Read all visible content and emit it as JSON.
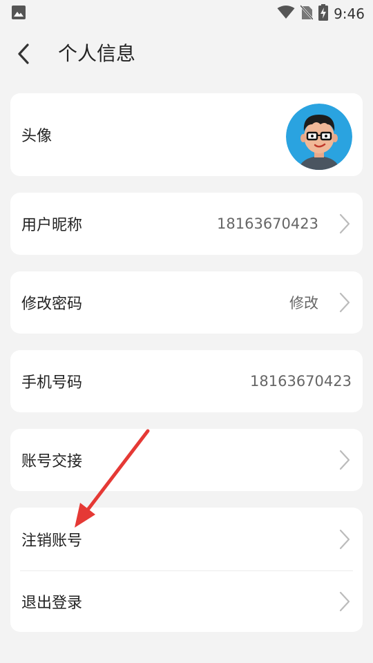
{
  "status_bar": {
    "time": "9:46",
    "icons": [
      "image-notification-icon",
      "wifi-icon",
      "no-sim-icon",
      "battery-charging-icon"
    ]
  },
  "header": {
    "title": "个人信息",
    "back_icon": "back-arrow-icon"
  },
  "rows": {
    "avatar": {
      "label": "头像"
    },
    "nickname": {
      "label": "用户昵称",
      "value": "18163670423"
    },
    "password": {
      "label": "修改密码",
      "value": "修改"
    },
    "phone": {
      "label": "手机号码",
      "value": "18163670423"
    },
    "handover": {
      "label": "账号交接"
    },
    "cancel_account": {
      "label": "注销账号"
    },
    "logout": {
      "label": "退出登录"
    }
  },
  "colors": {
    "background": "#f3f3f3",
    "card": "#ffffff",
    "annotation_arrow": "#e53935",
    "avatar_bg": "#2aa3e0"
  }
}
